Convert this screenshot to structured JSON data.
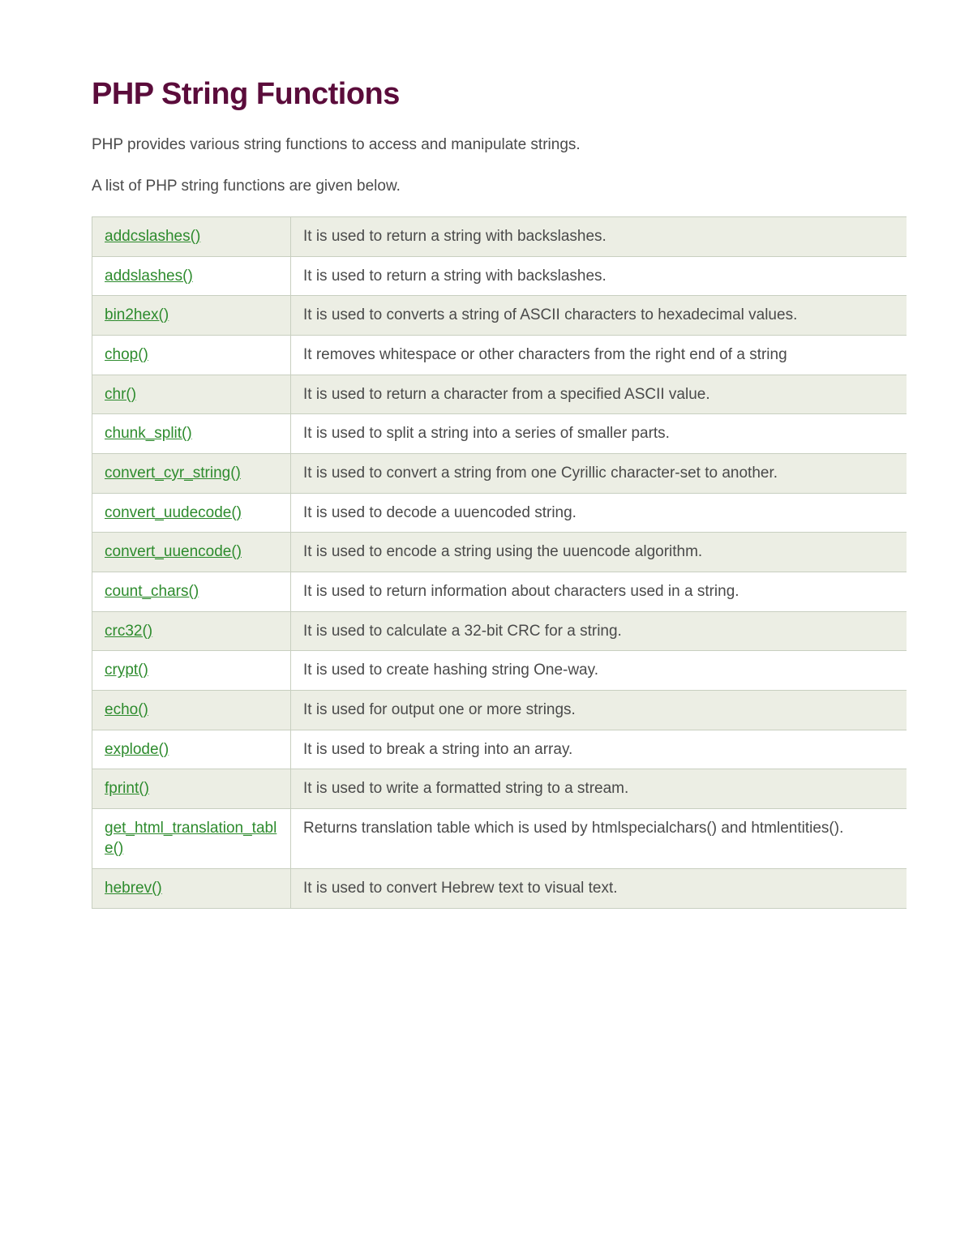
{
  "page": {
    "title": "PHP String Functions",
    "intro1": "PHP provides various string functions to access and manipulate strings.",
    "intro2": "A list of PHP string functions are given below."
  },
  "functions": [
    {
      "name": "addcslashes()",
      "desc": "It is used to return a string with backslashes."
    },
    {
      "name": "addslashes()",
      "desc": "It is used to return a string with backslashes."
    },
    {
      "name": "bin2hex()",
      "desc": "It is used to converts a string of ASCII characters to hexadecimal values."
    },
    {
      "name": "chop()",
      "desc": "It removes whitespace or other characters from the right end of a string"
    },
    {
      "name": "chr()",
      "desc": "It is used to return a character from a specified ASCII value."
    },
    {
      "name": "chunk_split()",
      "desc": "It is used to split a string into a series of smaller parts."
    },
    {
      "name": "convert_cyr_string()",
      "desc": "It is used to convert a string from one Cyrillic character-set to another."
    },
    {
      "name": "convert_uudecode()",
      "desc": "It is used to decode a uuencoded string."
    },
    {
      "name": "convert_uuencode()",
      "desc": "It is used to encode a string using the uuencode algorithm."
    },
    {
      "name": "count_chars()",
      "desc": "It is used to return information about characters used in a string."
    },
    {
      "name": "crc32()",
      "desc": "It is used to calculate a 32-bit CRC for a string."
    },
    {
      "name": "crypt()",
      "desc": "It is used to create hashing string One-way."
    },
    {
      "name": "echo()",
      "desc": "It is used for output one or more strings."
    },
    {
      "name": "explode()",
      "desc": "It is used to break a string into an array."
    },
    {
      "name": "fprint()",
      "desc": "It is used to write a formatted string to a stream."
    },
    {
      "name": "get_html_translation_table()",
      "desc": "Returns translation table which is used by htmlspecialchars() and htmlentities()."
    },
    {
      "name": "hebrev()",
      "desc": "It is used to convert Hebrew text to visual text."
    }
  ]
}
